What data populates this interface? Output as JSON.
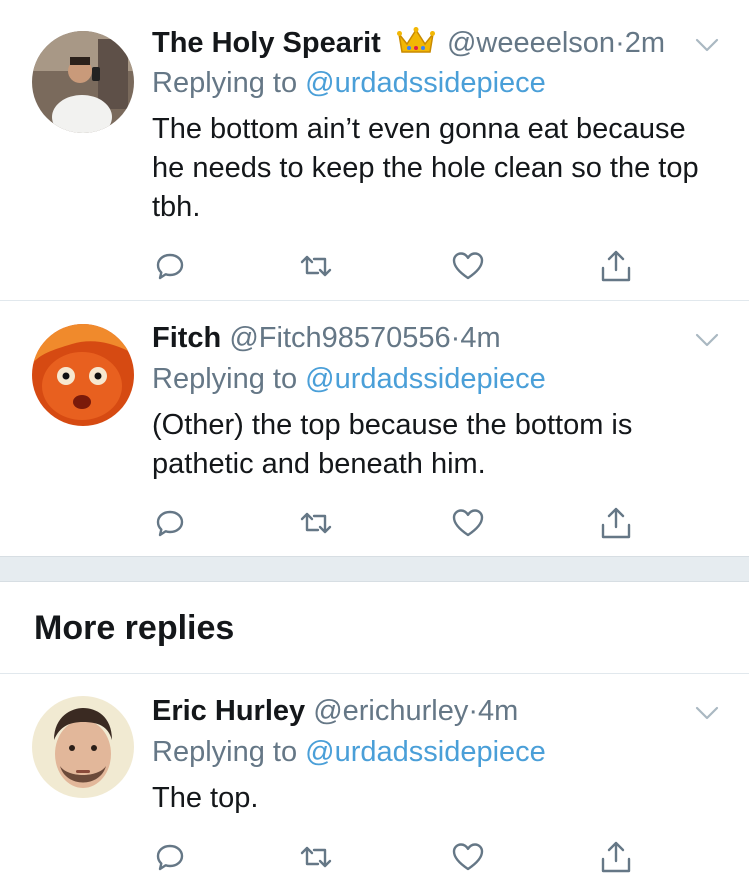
{
  "tweets": [
    {
      "name": "The Holy Spearit",
      "badge": "crown-emoji",
      "handle": "@weeeelson",
      "dot": "·",
      "time": "2m",
      "replying_prefix": "Replying to",
      "replying_to": "@urdadssidepiece",
      "text": "The bottom ain’t even gonna eat because he needs to keep the hole clean so the top tbh."
    },
    {
      "name": "Fitch",
      "handle": "@Fitch98570556",
      "dot": "·",
      "time": "4m",
      "replying_prefix": "Replying to",
      "replying_to": "@urdadssidepiece",
      "text": "(Other) the top because the bottom is pathetic and beneath him."
    },
    {
      "name": "Eric Hurley",
      "handle": "@erichurley",
      "dot": "·",
      "time": "4m",
      "replying_prefix": "Replying to",
      "replying_to": "@urdadssidepiece",
      "text": "The top."
    }
  ],
  "section": {
    "more_replies": "More replies"
  },
  "icons": {
    "reply": "reply-icon",
    "retweet": "retweet-icon",
    "like": "heart-icon",
    "share": "share-icon",
    "menu": "chevron-down-icon"
  },
  "colors": {
    "link": "#4a9fd8",
    "muted": "#657786",
    "text": "#14171a",
    "divider": "#e1e8ed",
    "section_gap": "#e6ecf0"
  }
}
